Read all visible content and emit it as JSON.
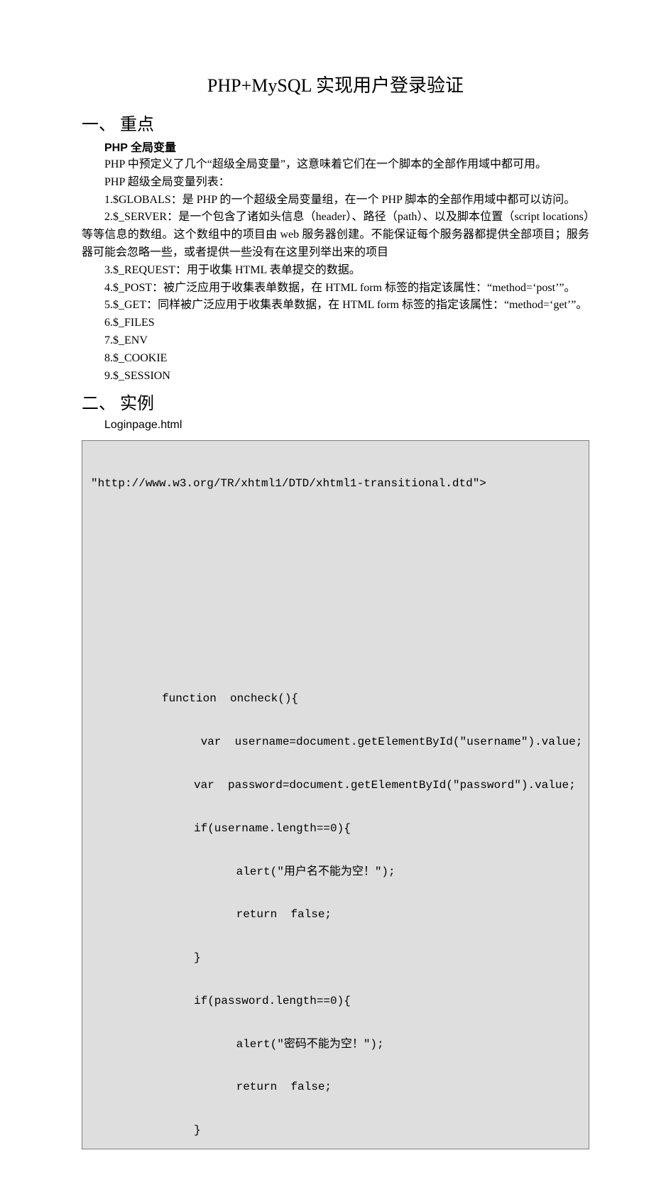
{
  "title": "PHP+MySQL 实现用户登录验证",
  "section1": {
    "heading": "一、 重点",
    "subheading": "PHP 全局变量",
    "p1": "PHP 中预定义了几个“超级全局变量”，这意味着它们在一个脚本的全部作用域中都可用。",
    "p2": "PHP 超级全局变量列表：",
    "item1": "1.$GLOBALS：是 PHP 的一个超级全局变量组，在一个 PHP 脚本的全部作用域中都可以访问。",
    "item2": "2.$_SERVER：是一个包含了诸如头信息（header）、路径（path）、以及脚本位置（script  locations）等等信息的数组。这个数组中的项目由 web 服务器创建。不能保证每个服务器都提供全部项目；服务器可能会忽略一些，或者提供一些没有在这里列举出来的项目",
    "item3": "3.$_REQUEST：用于收集 HTML 表单提交的数据。",
    "item4": "4.$_POST：被广泛应用于收集表单数据，在 HTML form 标签的指定该属性：“method=‘post’”。",
    "item5": "5.$_GET：同样被广泛应用于收集表单数据，在 HTML form 标签的指定该属性：“method=‘get’”。",
    "item6": "6.$_FILES",
    "item7": "7.$_ENV",
    "item8": "8.$_COOKIE",
    "item9": "9.$_SESSION"
  },
  "section2": {
    "heading": "二、 实例",
    "label": "Loginpage.html",
    "code": {
      "l1": "\"http://www.w3.org/TR/xhtml1/DTD/xhtml1-transitional.dtd\">",
      "l2": "function  oncheck(){",
      "l3": " var  username=document.getElementById(\"username\").value;",
      "l4": "var  password=document.getElementById(\"password\").value;",
      "l5": "if(username.length==0){",
      "l6": " alert(\"用户名不能为空！\");",
      "l7": " return  false;",
      "l8": "}",
      "l9": "if(password.length==0){",
      "l10": " alert(\"密码不能为空！\");",
      "l11": " return  false;",
      "l12": "}"
    }
  }
}
